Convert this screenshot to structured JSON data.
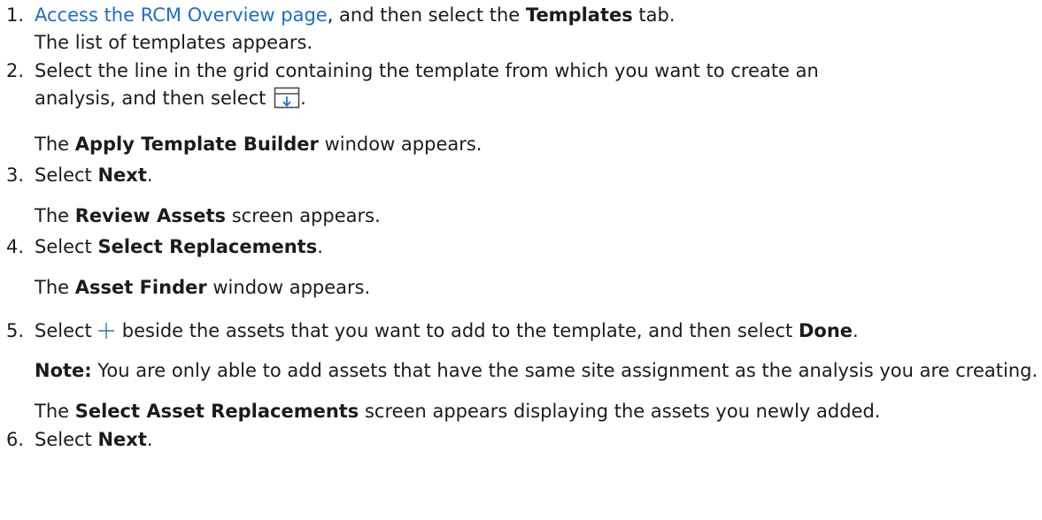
{
  "steps": [
    {
      "number": "1.",
      "link_text": "Access the RCM Overview page",
      "text_after_link": ", and then select the ",
      "bold": "Templates",
      "text_end": " tab.",
      "result": "The list of templates appears."
    },
    {
      "number": "2.",
      "text_line1": "Select the line in the grid containing the template from which you want to create an",
      "text_line2": "analysis, and then select ",
      "icon": "apply-template-icon",
      "text_end": ".",
      "result_prefix": "The ",
      "result_bold": "Apply Template Builder",
      "result_suffix": " window appears."
    },
    {
      "number": "3.",
      "text_prefix": "Select ",
      "bold": "Next",
      "text_end": ".",
      "result_prefix": "The ",
      "result_bold": "Review Assets",
      "result_suffix": " screen appears."
    },
    {
      "number": "4.",
      "text_prefix": "Select ",
      "bold": "Select Replacements",
      "text_end": ".",
      "result_prefix": "The ",
      "result_bold": "Asset Finder",
      "result_suffix": " window appears."
    },
    {
      "number": "5.",
      "text_prefix": "Select",
      "icon": "plus-icon",
      "text_middle": "beside the assets that you want to add to the template, and then select ",
      "bold": "Done",
      "text_end": ".",
      "note_label": "Note:",
      "note_text": " You are only able to add assets that have the same site assignment as the analysis you are creating.",
      "result_prefix": "The ",
      "result_bold": "Select Asset Replacements",
      "result_suffix": " screen appears displaying the assets you newly added."
    },
    {
      "number": "6.",
      "text_prefix": "Select ",
      "bold": "Next",
      "text_end": "."
    }
  ]
}
